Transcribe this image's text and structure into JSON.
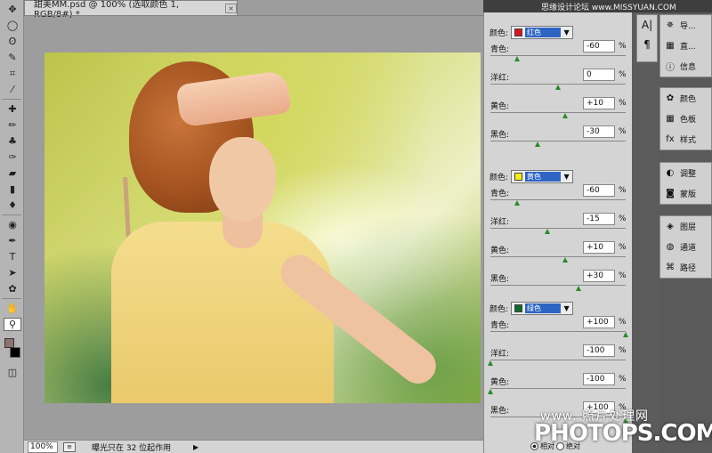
{
  "document": {
    "tab_title": "甜美MM.psd @ 100% (选取颜色 1, RGB/8#) *",
    "tab_close": "×",
    "zoom": "100%",
    "status_text": "曝光只在 32 位起作用",
    "play_icon": "▶"
  },
  "watermark": {
    "top": "思缘设计论坛 www.MISSYUAN.COM",
    "line1": "www.  照片处理网",
    "line2": "PHOTOPS.COM"
  },
  "tools": [
    "move-icon",
    "marquee-icon",
    "lasso-icon",
    "quick-select-icon",
    "crop-icon",
    "eyedropper-icon",
    "heal-icon",
    "brush-icon",
    "stamp-icon",
    "history-brush-icon",
    "eraser-icon",
    "gradient-icon",
    "blur-icon",
    "dodge-icon",
    "pen-icon",
    "type-icon",
    "path-select-icon",
    "shape-icon",
    "hand-icon",
    "zoom-icon"
  ],
  "tool_glyphs": [
    "✥",
    "◯",
    "ʘ",
    "✎",
    "⌗",
    "⁄",
    "✚",
    "✏",
    "♣",
    "✑",
    "▰",
    "▮",
    "♦",
    "◉",
    "✒",
    "T",
    "➤",
    "✿",
    "✋",
    "⚲"
  ],
  "selective_color": {
    "groups": [
      {
        "label": "颜色:",
        "color_name": "红色",
        "swatch": "#d8141c",
        "rows": [
          {
            "label": "青色:",
            "value": "-60",
            "pct": "%",
            "slider": 0.2
          },
          {
            "label": "洋红:",
            "value": "0",
            "pct": "%",
            "slider": 0.5
          },
          {
            "label": "黄色:",
            "value": "+10",
            "pct": "%",
            "slider": 0.55
          },
          {
            "label": "黑色:",
            "value": "-30",
            "pct": "%",
            "slider": 0.35
          }
        ]
      },
      {
        "label": "颜色:",
        "color_name": "黄色",
        "swatch": "#f5ee12",
        "rows": [
          {
            "label": "青色:",
            "value": "-60",
            "pct": "%",
            "slider": 0.2
          },
          {
            "label": "洋红:",
            "value": "-15",
            "pct": "%",
            "slider": 0.42
          },
          {
            "label": "黄色:",
            "value": "+10",
            "pct": "%",
            "slider": 0.55
          },
          {
            "label": "黑色:",
            "value": "+30",
            "pct": "%",
            "slider": 0.65
          }
        ]
      },
      {
        "label": "颜色:",
        "color_name": "绿色",
        "swatch": "#0f6a2a",
        "rows": [
          {
            "label": "青色:",
            "value": "+100",
            "pct": "%",
            "slider": 1.0
          },
          {
            "label": "洋红:",
            "value": "-100",
            "pct": "%",
            "slider": 0.0
          },
          {
            "label": "黄色:",
            "value": "-100",
            "pct": "%",
            "slider": 0.0
          },
          {
            "label": "黑色:",
            "value": "+100",
            "pct": "%",
            "slider": 1.0
          }
        ]
      }
    ],
    "mode": {
      "relative": "相对",
      "absolute": "绝对"
    }
  },
  "char_tools": [
    "A|",
    "¶"
  ],
  "panels": {
    "group1": [
      {
        "icon": "navigator-icon",
        "glyph": "✵",
        "label": "导..."
      },
      {
        "icon": "histogram-icon",
        "glyph": "▦",
        "label": "直..."
      },
      {
        "icon": "info-icon",
        "glyph": "ⓘ",
        "label": "信息"
      }
    ],
    "group2": [
      {
        "icon": "color-icon",
        "glyph": "✿",
        "label": "颜色"
      },
      {
        "icon": "swatches-icon",
        "glyph": "▦",
        "label": "色板"
      },
      {
        "icon": "styles-icon",
        "glyph": "fx",
        "label": "样式"
      }
    ],
    "group3": [
      {
        "icon": "adjustments-icon",
        "glyph": "◐",
        "label": "调整"
      },
      {
        "icon": "masks-icon",
        "glyph": "◙",
        "label": "蒙版"
      }
    ],
    "group4": [
      {
        "icon": "layers-icon",
        "glyph": "◈",
        "label": "图层"
      },
      {
        "icon": "channels-icon",
        "glyph": "◍",
        "label": "通道"
      },
      {
        "icon": "paths-icon",
        "glyph": "⌘",
        "label": "路径"
      }
    ]
  }
}
